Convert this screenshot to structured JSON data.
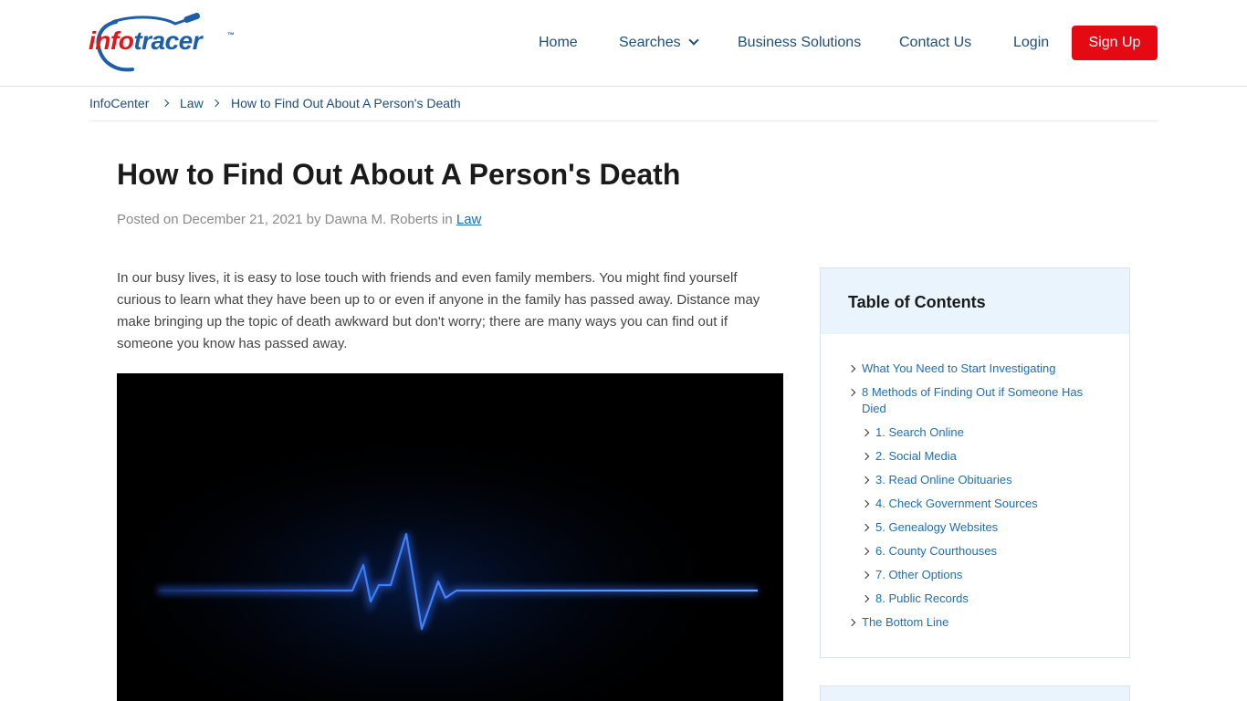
{
  "brand": {
    "logo_info": "info",
    "logo_tracer": "tracer",
    "logo_tm": "™",
    "colors": {
      "red": "#e3141b",
      "blue": "#1d5ea8",
      "signup": "#e50914",
      "nav": "#1f4e79",
      "link": "#1d6fb8"
    }
  },
  "nav": {
    "home": "Home",
    "searches": "Searches",
    "business": "Business Solutions",
    "contact": "Contact Us",
    "login": "Login",
    "signup": "Sign Up"
  },
  "breadcrumb": [
    "InfoCenter",
    "Law",
    "How to Find Out About A Person's Death"
  ],
  "article": {
    "title": "How to Find Out About A Person's Death",
    "meta_prefix": "Posted on December 21, 2021 by Dawna M. Roberts in",
    "meta_category": "Law",
    "intro": " In our busy lives, it is easy to lose touch with friends and even family members. You might find yourself curious to learn what they have been up to or even if anyone in the family has passed away. Distance may make bringing up the topic of death awkward but don't worry; there are many ways you can find out if someone you know has passed away."
  },
  "toc": {
    "title": "Table of Contents",
    "items": [
      "What You Need to Start Investigating",
      "8 Methods of Finding Out if Someone Has Died",
      "1. Search Online",
      "2. Social Media",
      "3. Read Online Obituaries",
      "4. Check Government Sources",
      "5. Genealogy Websites",
      "6. County Courthouses",
      "7. Other Options",
      "8. Public Records",
      "The Bottom Line"
    ]
  }
}
